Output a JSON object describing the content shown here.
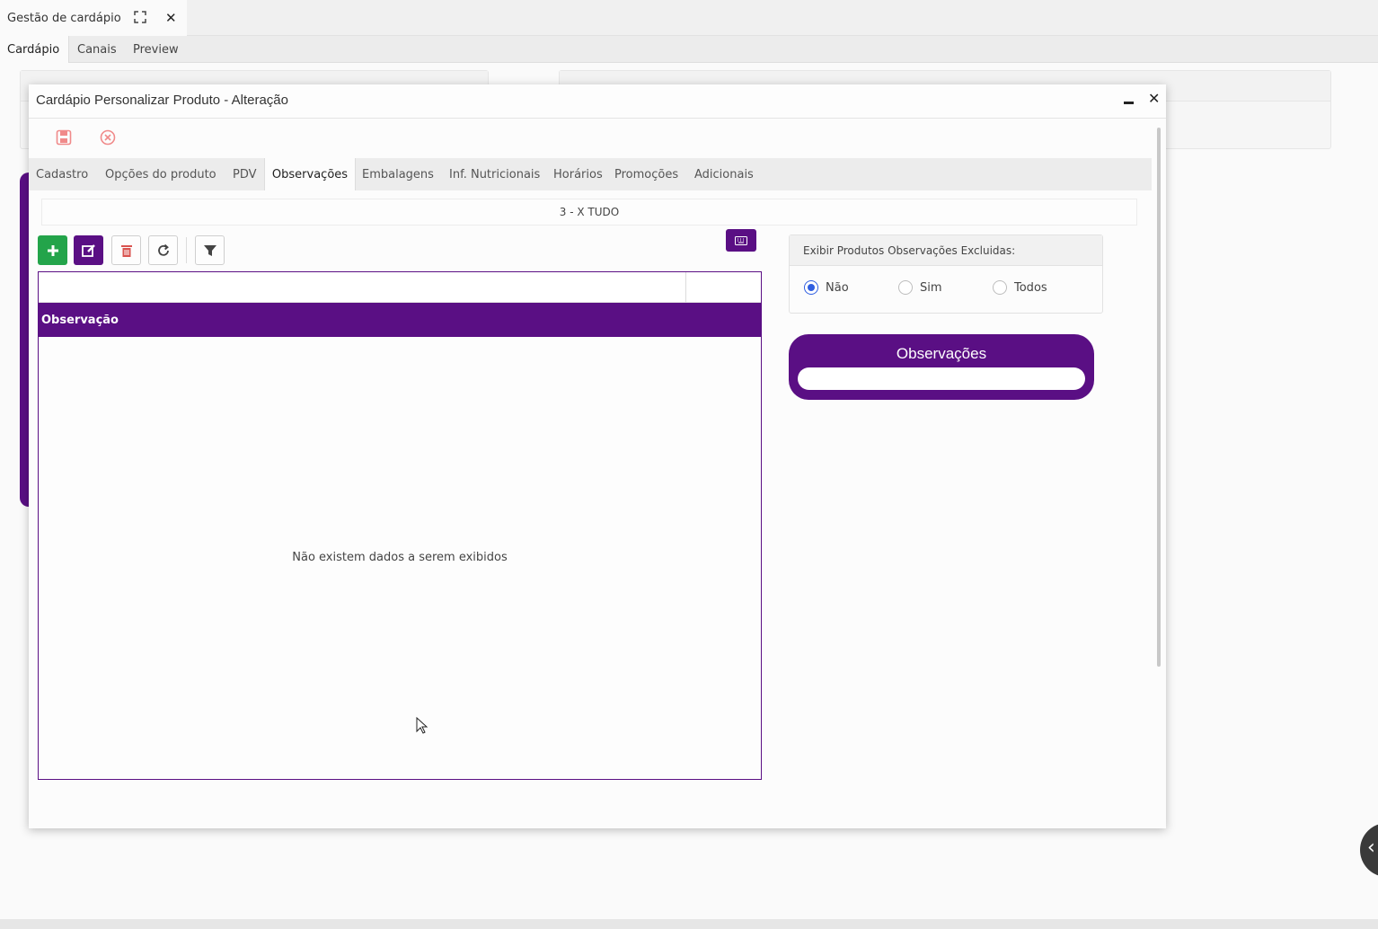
{
  "app": {
    "tab_title": "Gestão de cardápio",
    "sub_tabs": [
      "Cardápio",
      "Canais",
      "Preview"
    ]
  },
  "modal": {
    "title": "Cardápio Personalizar Produto - Alteração",
    "tabs": [
      "Cadastro",
      "Opções do produto",
      "PDV",
      "Observações",
      "Embalagens",
      "Inf. Nutricionais",
      "Horários",
      "Promoções",
      "Adicionais"
    ],
    "active_tab": "Observações",
    "product_label": "3 - X TUDO"
  },
  "grid": {
    "column_header": "Observação",
    "empty_message": "Não existem dados a serem exibidos"
  },
  "excluded_filter": {
    "label": "Exibir Produtos Observações Excluidas:",
    "options": [
      "Não",
      "Sim",
      "Todos"
    ],
    "selected": "Não"
  },
  "observations_card": {
    "title": "Observações",
    "value": ""
  },
  "colors": {
    "brand_purple": "#5a0f84",
    "add_green": "#23a44a",
    "radio_blue": "#2f5ee0",
    "delete_red": "#d9534f"
  },
  "icons": [
    "expand-icon",
    "close-icon",
    "save-icon",
    "cancel-icon",
    "plus-icon",
    "edit-icon",
    "trash-icon",
    "refresh-icon",
    "filter-icon",
    "keyboard-icon",
    "chevron-left-icon",
    "minimize-icon",
    "mouse-cursor-icon"
  ]
}
